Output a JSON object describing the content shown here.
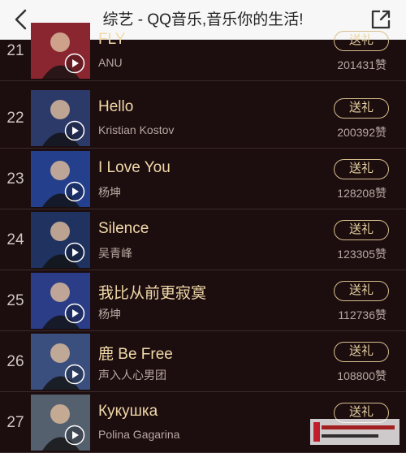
{
  "header": {
    "title": "综艺 - QQ音乐,音乐你的生活!",
    "back_icon": "chevron-left-icon",
    "share_icon": "share-external-icon"
  },
  "colors": {
    "background": "#1c0d0f",
    "title_gold": "#f1d9a8",
    "gift_border": "#d7bf8e",
    "secondary_text": "#b7a9a2"
  },
  "rows": [
    {
      "rank": "21",
      "title": "FLY",
      "artist": "ANU",
      "gift": "送礼",
      "likes": "201431赞",
      "thumb_color": "#8a2630"
    },
    {
      "rank": "22",
      "title": "Hello",
      "artist": "Kristian Kostov",
      "gift": "送礼",
      "likes": "200392赞",
      "thumb_color": "#2c3a6a"
    },
    {
      "rank": "23",
      "title": "I Love You",
      "artist": "杨坤",
      "gift": "送礼",
      "likes": "128208赞",
      "thumb_color": "#243f8c"
    },
    {
      "rank": "24",
      "title": "Silence",
      "artist": "吴青峰",
      "gift": "送礼",
      "likes": "123305赞",
      "thumb_color": "#1f3260"
    },
    {
      "rank": "25",
      "title": "我比从前更寂寞",
      "artist": "杨坤",
      "gift": "送礼",
      "likes": "112736赞",
      "thumb_color": "#2a3d86"
    },
    {
      "rank": "26",
      "title": "鹿 Be Free",
      "artist": "声入人心男团",
      "gift": "送礼",
      "likes": "108800赞",
      "thumb_color": "#3a4f7e"
    },
    {
      "rank": "27",
      "title": "Кукушка",
      "artist": "Polina Gagarina",
      "gift": "送礼",
      "likes": "",
      "thumb_color": "#55606f"
    }
  ]
}
